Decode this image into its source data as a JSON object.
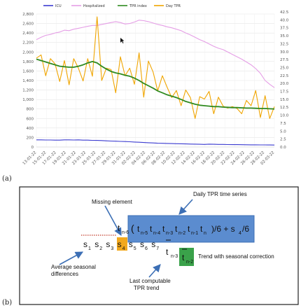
{
  "panel_a": {
    "label": "(a)"
  },
  "panel_b": {
    "label": "(b)",
    "annotations": {
      "daily_tpr": "Daily TPR time series",
      "missing": "Missing element",
      "avg_seasonal_1": "Average seasonal",
      "avg_seasonal_2": "differences",
      "last_computable_1": "Last computable",
      "last_computable_2": "TPR trend",
      "trend_seasonal": "Trend with seasonal correction"
    },
    "formula": {
      "lead_t": "t",
      "lead_sub": "n-6",
      "open_paren": "(",
      "terms": [
        {
          "t": "t",
          "sub": "n-5"
        },
        {
          "t": "t",
          "sub": "n-4"
        },
        {
          "t": "t",
          "sub": "n-3"
        },
        {
          "t": "t",
          "sub": "n-2"
        },
        {
          "t": "t",
          "sub": "n-1"
        },
        {
          "t": "t",
          "sub": "n"
        }
      ],
      "tail": ")/6 + s",
      "tail_sub": "4",
      "tail_end": "/6"
    },
    "s_row": [
      {
        "s": "s",
        "sub": "1"
      },
      {
        "s": "s",
        "sub": "2"
      },
      {
        "s": "s",
        "sub": "3"
      },
      {
        "s": "s",
        "sub": "4"
      },
      {
        "s": "s",
        "sub": "5"
      },
      {
        "s": "s",
        "sub": "6"
      },
      {
        "s": "s",
        "sub": "7"
      }
    ],
    "tbar_n3": {
      "t": "t",
      "sub": "n-3"
    },
    "tbar_n2": {
      "t": "t",
      "sub": "n-2"
    },
    "colors": {
      "blue_box": "#5b8ccf",
      "orange_box": "#f2a81d",
      "green_box": "#3aa24a",
      "arrow": "#3c6fb5"
    }
  },
  "chart_data": {
    "type": "line",
    "legend": [
      "ICU",
      "Hospitalized",
      "TPR index",
      "Day TPR"
    ],
    "colors": {
      "ICU": "#3b3bd0",
      "Hospitalized": "#e59ee6",
      "TPR index": "#2f8a1f",
      "Day TPR": "#f0a500"
    },
    "x": [
      "13-01-22",
      "15-01-22",
      "17-01-22",
      "19-01-22",
      "21-01-22",
      "23-01-22",
      "25-01-22",
      "27-01-22",
      "29-01-22",
      "31-01-22",
      "02-02-22",
      "04-02-22",
      "06-02-22",
      "08-02-22",
      "10-02-22",
      "12-02-22",
      "14-02-22",
      "16-02-22",
      "18-02-22",
      "20-02-22",
      "22-02-22",
      "24-02-22",
      "26-02-22",
      "28-02-22",
      "02-03-22"
    ],
    "y_left_ticks": [
      "0",
      "200",
      "400",
      "600",
      "800",
      "1,000",
      "1,200",
      "1,400",
      "1,600",
      "1,800",
      "2,000",
      "2,200",
      "2,400",
      "2,600",
      "2,800"
    ],
    "y_right_ticks": [
      "0.0",
      "2.5",
      "5.0",
      "7.5",
      "10.0",
      "12.5",
      "15.0",
      "17.5",
      "20.0",
      "22.5",
      "25.0",
      "27.5",
      "30.0",
      "32.5",
      "35.0",
      "37.5",
      "40.0",
      "42.5"
    ],
    "ylim_left": [
      0,
      2800
    ],
    "ylim_right": [
      0,
      42.5
    ],
    "series": [
      {
        "name": "ICU",
        "axis": "left",
        "values": [
          150,
          150,
          148,
          148,
          145,
          145,
          150,
          150,
          148,
          150,
          145,
          145,
          140,
          138,
          135,
          130,
          125,
          122,
          118,
          115,
          110,
          105,
          100,
          95,
          90,
          85,
          80,
          78,
          75,
          72,
          70,
          68,
          65,
          62,
          60,
          58,
          55,
          60,
          58,
          55,
          55,
          52,
          50,
          50,
          48,
          47,
          46,
          45,
          44,
          44,
          43,
          42
        ]
      },
      {
        "name": "Hospitalized",
        "axis": "left",
        "values": [
          2260,
          2310,
          2350,
          2370,
          2400,
          2420,
          2460,
          2450,
          2480,
          2500,
          2520,
          2540,
          2560,
          2560,
          2580,
          2600,
          2620,
          2640,
          2620,
          2590,
          2600,
          2630,
          2670,
          2660,
          2640,
          2610,
          2580,
          2560,
          2530,
          2510,
          2480,
          2450,
          2400,
          2360,
          2310,
          2260,
          2220,
          2170,
          2120,
          2080,
          2050,
          2000,
          1950,
          1900,
          1850,
          1790,
          1730,
          1650,
          1550,
          1400,
          1320,
          1250
        ]
      },
      {
        "name": "TPR index",
        "axis": "left",
        "values": [
          1850,
          1820,
          1790,
          1760,
          1730,
          1700,
          1690,
          1680,
          1680,
          1700,
          1730,
          1770,
          1800,
          1770,
          1700,
          1640,
          1590,
          1560,
          1540,
          1510,
          1490,
          1450,
          1400,
          1340,
          1290,
          1240,
          1180,
          1140,
          1100,
          1070,
          1040,
          1000,
          960,
          930,
          900,
          880,
          870,
          860,
          850,
          850,
          840,
          835,
          830,
          830,
          825,
          820,
          820,
          815,
          810,
          810,
          805,
          800
        ]
      },
      {
        "name": "Day TPR",
        "axis": "left",
        "values": [
          1870,
          1940,
          1500,
          1860,
          1750,
          1380,
          1820,
          1310,
          1860,
          1660,
          1390,
          1860,
          1490,
          2740,
          1400,
          1660,
          1630,
          1140,
          1900,
          1500,
          1660,
          1320,
          1980,
          1050,
          1810,
          1580,
          1180,
          1500,
          1260,
          1040,
          1190,
          870,
          1200,
          1040,
          600,
          1060,
          1010,
          1170,
          700,
          1050,
          860,
          820,
          850,
          810,
          700,
          980,
          870,
          1190,
          620,
          1080,
          600,
          850
        ]
      }
    ]
  }
}
